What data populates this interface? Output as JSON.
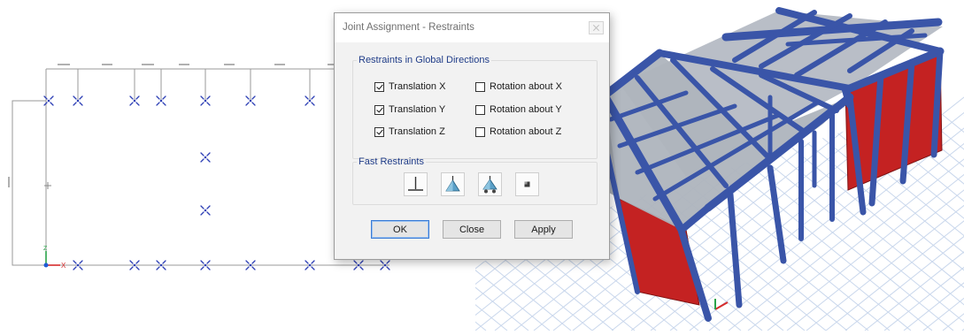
{
  "dialog": {
    "title": "Joint Assignment - Restraints",
    "restraints_group": {
      "legend": "Restraints in Global Directions",
      "items": [
        {
          "label": "Translation  X",
          "checked": true
        },
        {
          "label": "Rotation about  X",
          "checked": false
        },
        {
          "label": "Translation  Y",
          "checked": true
        },
        {
          "label": "Rotation about  Y",
          "checked": false
        },
        {
          "label": "Translation  Z",
          "checked": true
        },
        {
          "label": "Rotation about  Z",
          "checked": false
        }
      ]
    },
    "fast_group": {
      "legend": "Fast Restraints",
      "buttons": [
        "fixed-support-icon",
        "pinned-support-icon",
        "roller-support-icon",
        "free-joint-icon"
      ]
    },
    "buttons": {
      "ok": "OK",
      "close": "Close",
      "apply": "Apply"
    }
  },
  "plan_view": {
    "axis_labels": {
      "x": "X",
      "z": "Z"
    }
  },
  "colors": {
    "frame_blue": "#3a55a8",
    "wall_red": "#c42222",
    "glass_gray": "#b3b9c2",
    "grid_line": "#c9d7ec",
    "legend_blue": "#1f3c88"
  }
}
